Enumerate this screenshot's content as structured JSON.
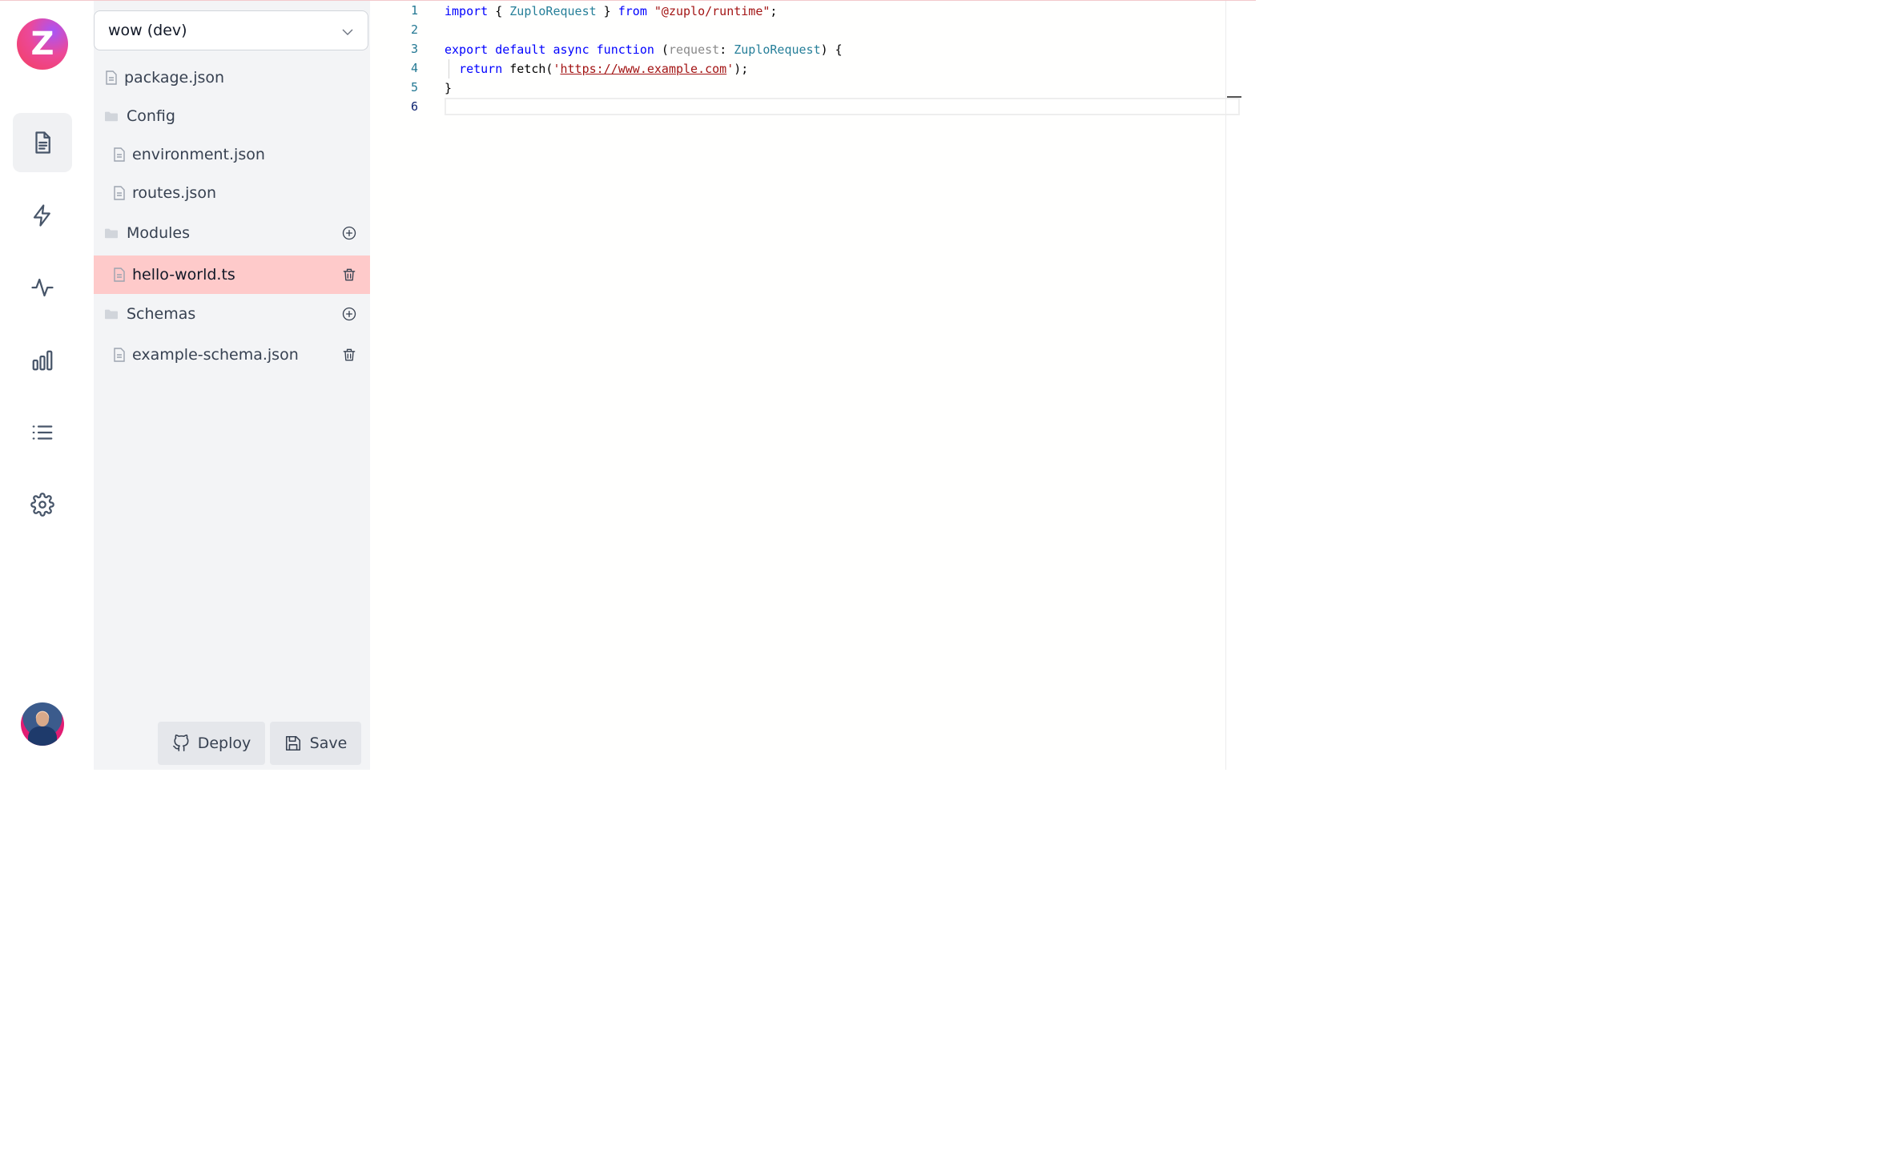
{
  "app": {
    "logo_letter": "Z",
    "brand_color": "#ec4899"
  },
  "rail": {
    "items": [
      {
        "name": "files",
        "icon": "document-icon",
        "active": true
      },
      {
        "name": "routes",
        "icon": "lightning-icon"
      },
      {
        "name": "activity",
        "icon": "pulse-icon"
      },
      {
        "name": "analytics",
        "icon": "bar-chart-icon"
      },
      {
        "name": "logs",
        "icon": "list-icon"
      },
      {
        "name": "settings",
        "icon": "gear-icon"
      }
    ]
  },
  "environment": {
    "selected": "wow (dev)"
  },
  "files": [
    {
      "label": "package.json",
      "type": "file"
    },
    {
      "label": "Config",
      "type": "folder"
    },
    {
      "label": "environment.json",
      "type": "file"
    },
    {
      "label": "routes.json",
      "type": "file"
    },
    {
      "label": "Modules",
      "type": "folder",
      "action": "add"
    },
    {
      "label": "hello-world.ts",
      "type": "file",
      "selected": true,
      "action": "delete"
    },
    {
      "label": "Schemas",
      "type": "folder",
      "action": "add"
    },
    {
      "label": "example-schema.json",
      "type": "file",
      "action": "delete"
    }
  ],
  "actions": {
    "deploy_label": "Deploy",
    "save_label": "Save"
  },
  "editor": {
    "line_numbers": [
      "1",
      "2",
      "3",
      "4",
      "5",
      "6"
    ],
    "lines": [
      "import { ZuploRequest } from \"@zuplo/runtime\";",
      "",
      "export default async function (request: ZuploRequest) {",
      "  return fetch('https://www.example.com');",
      "}",
      ""
    ]
  }
}
